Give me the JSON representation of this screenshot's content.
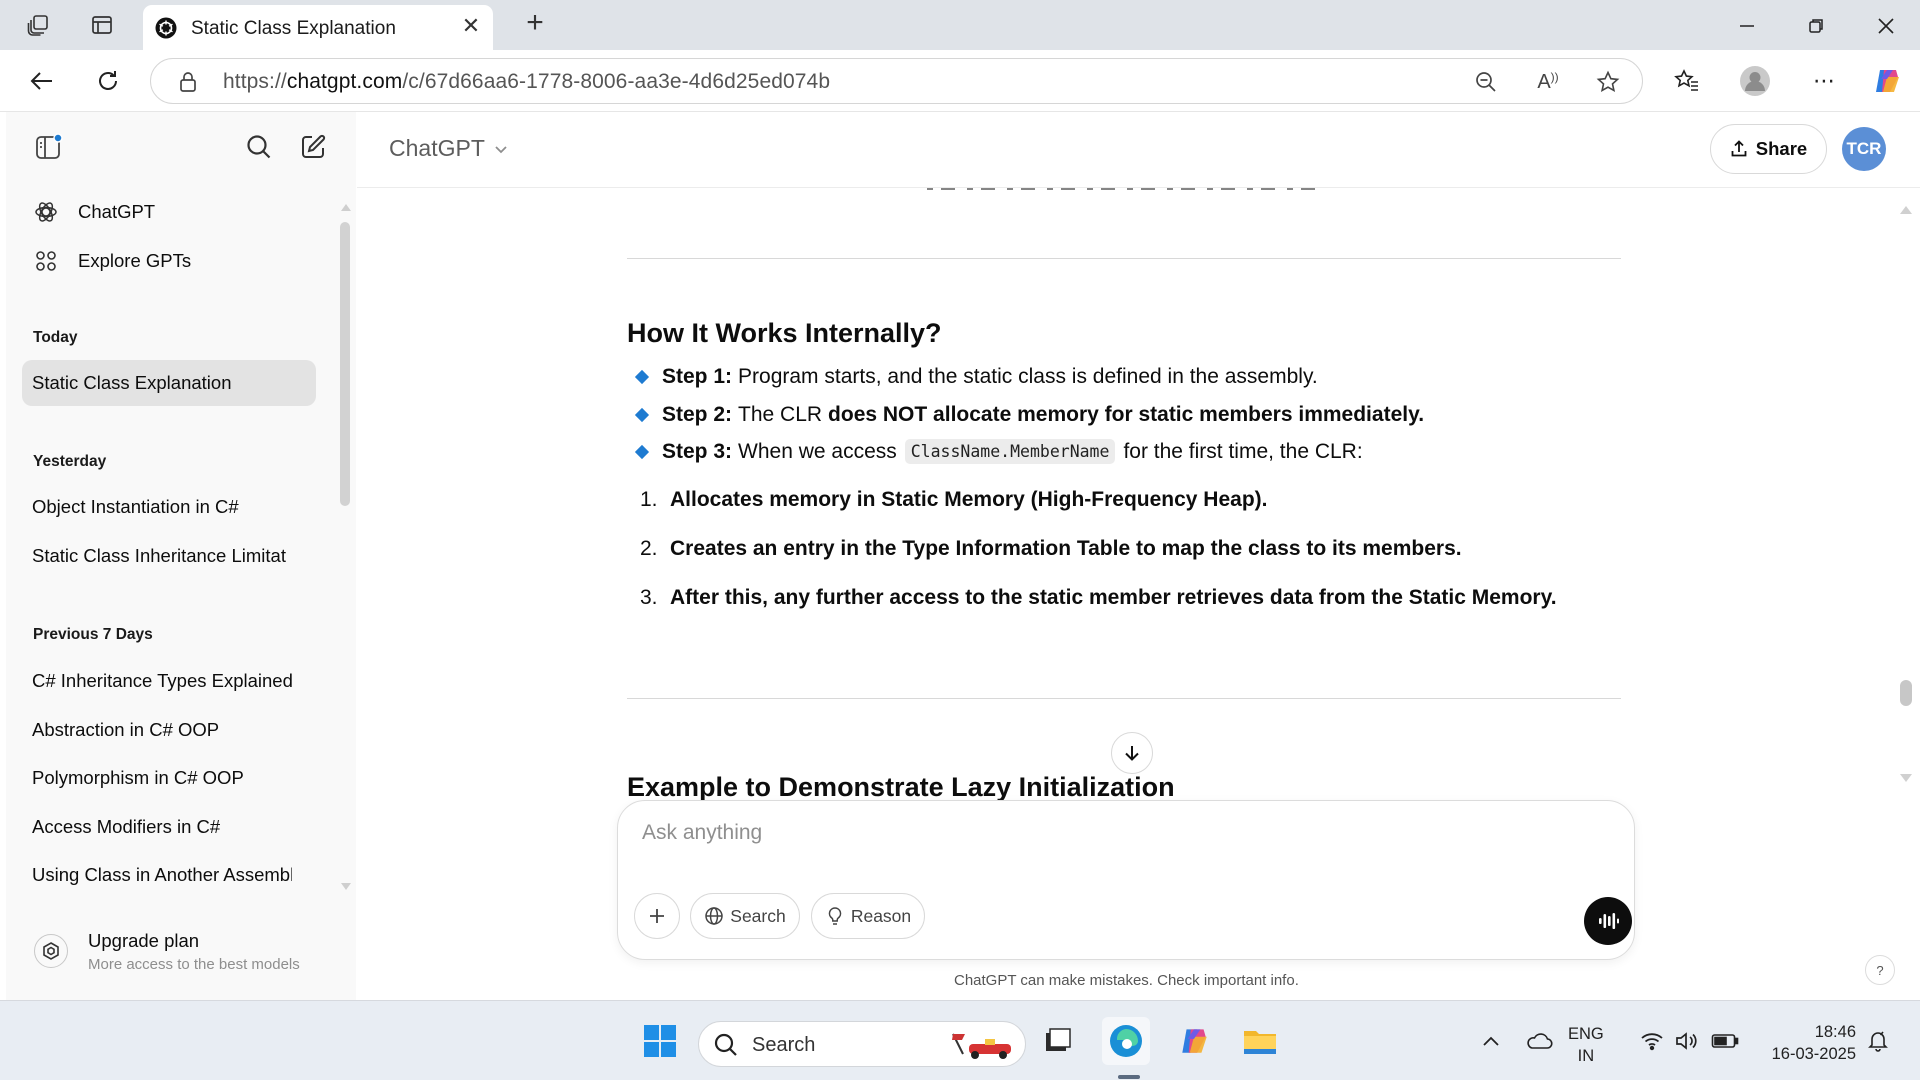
{
  "browser": {
    "tab_title": "Static Class Explanation",
    "new_tab": "+",
    "url_prefix": "https://",
    "url_host": "chatgpt.com",
    "url_path": "/c/67d66aa6-1778-8006-aa3e-4d6d25ed074b"
  },
  "sidebar": {
    "top_items": [
      {
        "label": "ChatGPT",
        "icon": "openai-logo-icon"
      },
      {
        "label": "Explore GPTs",
        "icon": "grid-icon"
      }
    ],
    "groups": [
      {
        "heading": "Today",
        "items": [
          "Static Class Explanation"
        ]
      },
      {
        "heading": "Yesterday",
        "items": [
          "Object Instantiation in C#",
          "Static Class Inheritance Limitat"
        ]
      },
      {
        "heading": "Previous 7 Days",
        "items": [
          "C# Inheritance Types Explained",
          "Abstraction in C# OOP",
          "Polymorphism in C# OOP",
          "Access Modifiers in C#",
          "Using Class in Another Assembly"
        ]
      }
    ],
    "upgrade_title": "Upgrade plan",
    "upgrade_subtitle": "More access to the best models"
  },
  "header": {
    "model": "ChatGPT",
    "share": "Share",
    "avatar": "TCR"
  },
  "content": {
    "heading": "How It Works Internally?",
    "steps": [
      {
        "label": "Step 1:",
        "text": "Program starts, and the static class is defined in the assembly."
      },
      {
        "label": "Step 2:",
        "text": "The CLR",
        "bold_text": "does NOT allocate memory for static members immediately."
      },
      {
        "label": "Step 3:",
        "text": "When we access",
        "code": "ClassName.MemberName",
        "text_after": "for the first time, the CLR:"
      }
    ],
    "numbered": [
      {
        "n": "1.",
        "text": "Allocates memory in Static Memory (High-Frequency Heap)."
      },
      {
        "n": "2.",
        "text": "Creates an entry in the Type Information Table to map the class to its members."
      },
      {
        "n": "3.",
        "text": "After this, any further access to the static member retrieves data from the Static Memory."
      }
    ],
    "next_heading": "Example to Demonstrate Lazy Initialization"
  },
  "composer": {
    "placeholder": "Ask anything",
    "search": "Search",
    "reason": "Reason"
  },
  "disclaimer": "ChatGPT can make mistakes. Check important info.",
  "help": "?",
  "taskbar": {
    "search_placeholder": "Search",
    "lang_line1": "ENG",
    "lang_line2": "IN",
    "time": "18:46",
    "date": "16-03-2025"
  },
  "colors": {
    "accent_blue": "#1e7bd1",
    "avatar_bg": "#5b8fd6",
    "sidebar_bg": "#f9f9f9",
    "active_item_bg": "#e3e3e3"
  }
}
